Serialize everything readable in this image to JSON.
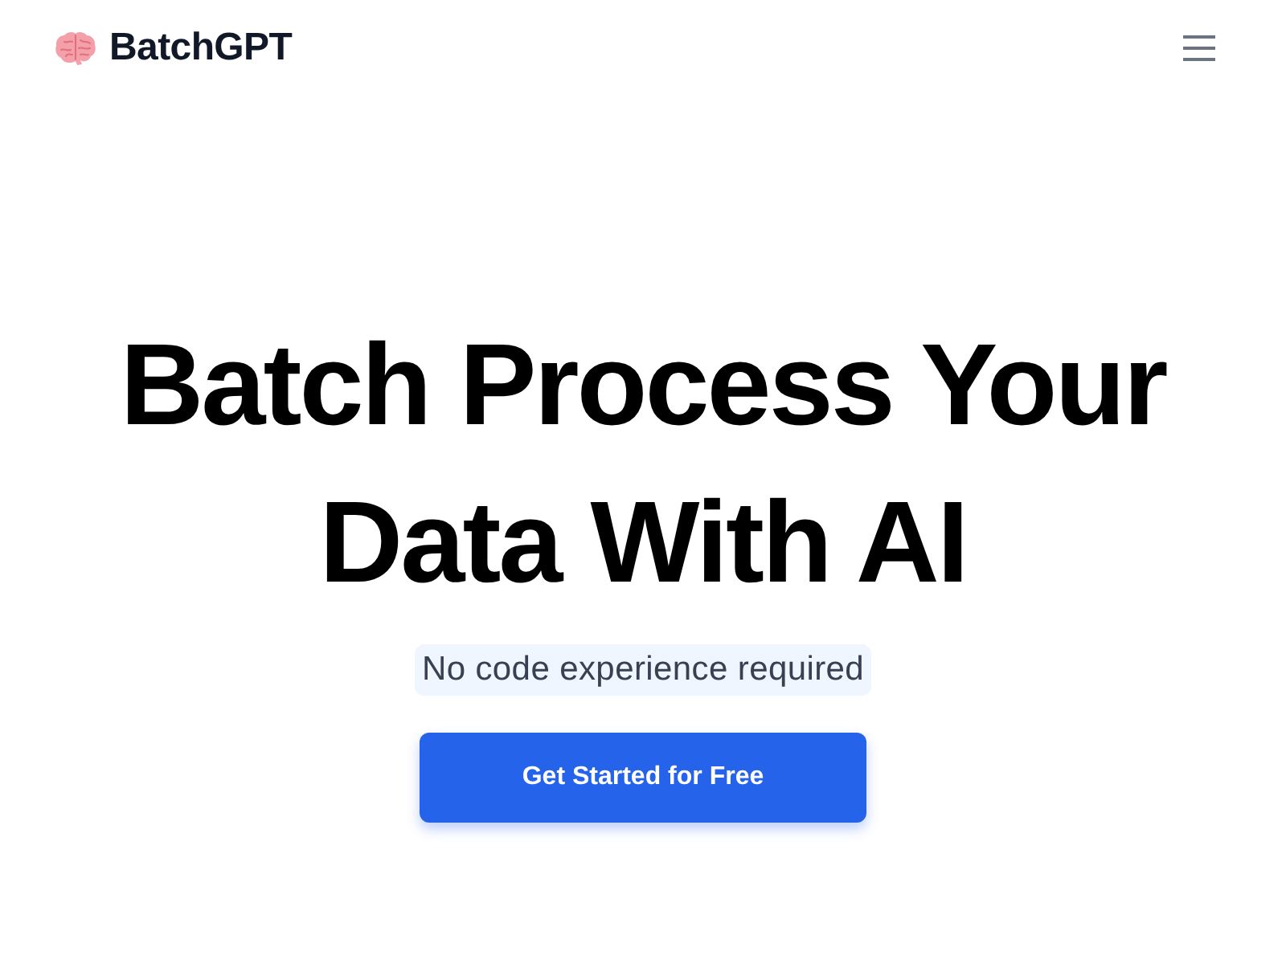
{
  "header": {
    "logo_text": "BatchGPT"
  },
  "hero": {
    "title": "Batch Process Your Data With AI",
    "subtitle": "No code experience required",
    "cta": "Get Started for Free"
  }
}
